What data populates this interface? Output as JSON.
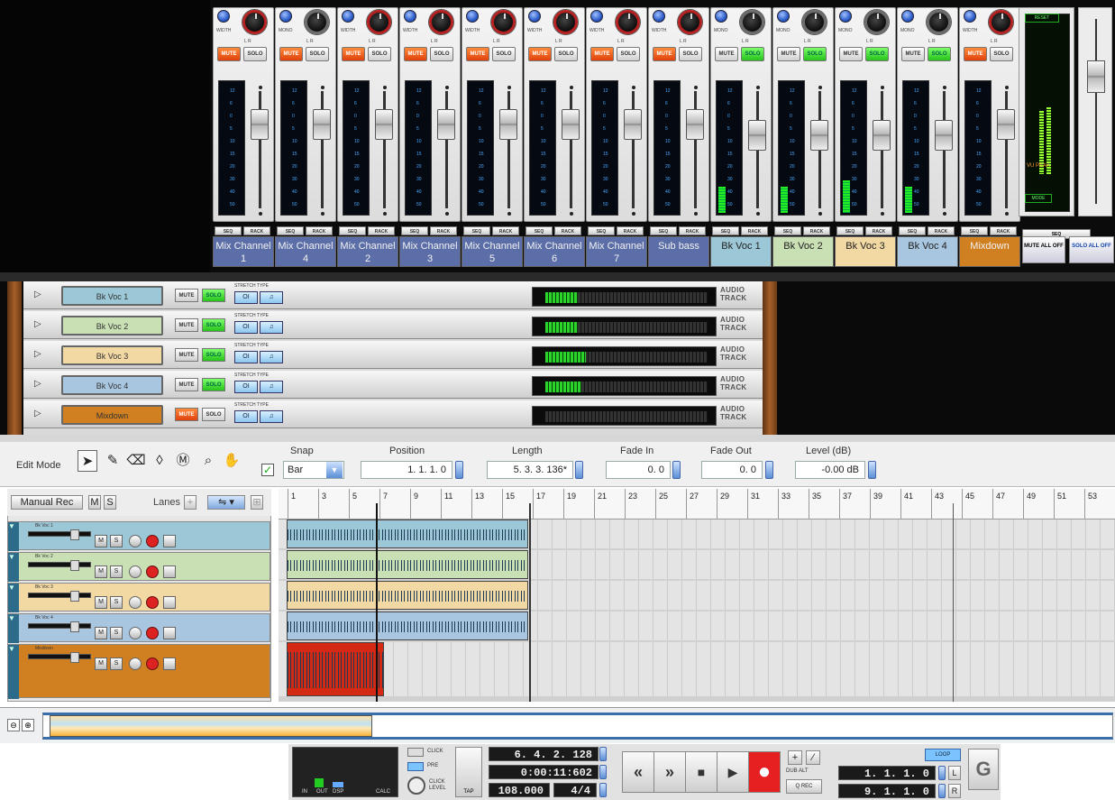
{
  "mixer": {
    "channels": [
      {
        "name": "Mix Channel 1",
        "label_color": "#5b6ea8",
        "mute_on": true,
        "solo_on": false,
        "knob": "red",
        "top_label": "WIDTH",
        "meter": 0
      },
      {
        "name": "Mix Channel 4",
        "label_color": "#5b6ea8",
        "mute_on": true,
        "solo_on": false,
        "knob": "gray",
        "top_label": "MONO",
        "meter": 0
      },
      {
        "name": "Mix Channel 2",
        "label_color": "#5b6ea8",
        "mute_on": true,
        "solo_on": false,
        "knob": "red",
        "top_label": "WIDTH",
        "meter": 0
      },
      {
        "name": "Mix Channel 3",
        "label_color": "#5b6ea8",
        "mute_on": true,
        "solo_on": false,
        "knob": "red",
        "top_label": "WIDTH",
        "meter": 0
      },
      {
        "name": "Mix Channel 5",
        "label_color": "#5b6ea8",
        "mute_on": true,
        "solo_on": false,
        "knob": "red",
        "top_label": "WIDTH",
        "meter": 0
      },
      {
        "name": "Mix Channel 6",
        "label_color": "#5b6ea8",
        "mute_on": true,
        "solo_on": false,
        "knob": "red",
        "top_label": "WIDTH",
        "meter": 0
      },
      {
        "name": "Mix Channel 7",
        "label_color": "#5b6ea8",
        "mute_on": true,
        "solo_on": false,
        "knob": "red",
        "top_label": "WIDTH",
        "meter": 0
      },
      {
        "name": "Sub bass",
        "label_color": "#5b6ea8",
        "mute_on": true,
        "solo_on": false,
        "knob": "red",
        "top_label": "WIDTH",
        "meter": 0
      },
      {
        "name": "Bk Voc 1",
        "label_color": "#9cc7d6",
        "mute_on": false,
        "solo_on": true,
        "knob": "gray",
        "top_label": "MONO",
        "meter": 0.2
      },
      {
        "name": "Bk Voc 2",
        "label_color": "#c9dfb4",
        "mute_on": false,
        "solo_on": true,
        "knob": "gray",
        "top_label": "MONO",
        "meter": 0.2
      },
      {
        "name": "Bk Voc 3",
        "label_color": "#f2d9a4",
        "mute_on": false,
        "solo_on": true,
        "knob": "gray",
        "top_label": "MONO",
        "meter": 0.25
      },
      {
        "name": "Bk Voc 4",
        "label_color": "#a9c6e0",
        "mute_on": false,
        "solo_on": true,
        "knob": "gray",
        "top_label": "MONO",
        "meter": 0.2
      },
      {
        "name": "Mixdown",
        "label_color": "#d08020",
        "mute_on": true,
        "solo_on": false,
        "knob": "red",
        "top_label": "WIDTH",
        "meter": 0
      }
    ],
    "mute_label": "MUTE",
    "solo_label": "SOLO",
    "seq_label": "SEQ",
    "rack_label": "RACK",
    "lr_label": "L   R",
    "meter_ticks": [
      "12",
      "6",
      "0",
      "5",
      "10",
      "15",
      "20",
      "30",
      "40",
      "50"
    ],
    "master": {
      "reset": "RESET",
      "vu_peak": "VU\nPEAK",
      "mode": "MODE",
      "seq": "SEQ",
      "mute_all": "MUTE\nALL OFF",
      "solo_all": "SOLO\nALL OFF"
    }
  },
  "rack": {
    "tracks": [
      {
        "name": "Bk Voc 1",
        "color": "#9cc7d6",
        "mute_on": false,
        "solo_on": true,
        "level": 0.2
      },
      {
        "name": "Bk Voc 2",
        "color": "#c9dfb4",
        "mute_on": false,
        "solo_on": true,
        "level": 0.2
      },
      {
        "name": "Bk Voc 3",
        "color": "#f2d9a4",
        "mute_on": false,
        "solo_on": true,
        "level": 0.25
      },
      {
        "name": "Bk Voc 4",
        "color": "#a9c6e0",
        "mute_on": false,
        "solo_on": true,
        "level": 0.22
      },
      {
        "name": "Mixdown",
        "color": "#d08020",
        "mute_on": true,
        "solo_on": false,
        "level": 0
      }
    ],
    "stretch_type": "STRETCH TYPE",
    "audio_track": "AUDIO TRACK",
    "mute_label": "MUTE",
    "solo_label": "SOLO"
  },
  "toolbar": {
    "edit_mode": "Edit Mode",
    "snap_label": "Snap",
    "snap_value": "Bar",
    "position_label": "Position",
    "position_value": "1.  1.  1.    0",
    "length_label": "Length",
    "length_value": "5.  3.  3. 136*",
    "fade_in_label": "Fade In",
    "fade_in_value": "0.    0",
    "fade_out_label": "Fade Out",
    "fade_out_value": "0.    0",
    "level_label": "Level (dB)",
    "level_value": "-0.00 dB"
  },
  "sequencer": {
    "manual_rec": "Manual Rec",
    "m": "M",
    "s": "S",
    "lanes_label": "Lanes",
    "ruler_marks": [
      "1",
      "3",
      "5",
      "7",
      "9",
      "11",
      "13",
      "15",
      "17",
      "19",
      "21",
      "23",
      "25",
      "27",
      "29",
      "31",
      "33",
      "35",
      "37",
      "39",
      "41",
      "43",
      "45",
      "47",
      "49",
      "51",
      "53"
    ],
    "lanes": [
      {
        "name": "Bk Voc 1",
        "color": "#9cc7d6"
      },
      {
        "name": "Bk Voc 2",
        "color": "#c9dfb4"
      },
      {
        "name": "Bk Voc 3",
        "color": "#f2d9a4"
      },
      {
        "name": "Bk Voc 4",
        "color": "#a9c6e0"
      },
      {
        "name": "Mixdown",
        "color": "#d08020"
      }
    ]
  },
  "transport": {
    "click": "CLICK",
    "pre": "PRE",
    "click_level": "CLICK LEVEL",
    "tap": "TAP",
    "in": "IN",
    "out": "OUT",
    "dsp": "DSP",
    "calc": "CALC",
    "position": "6.  4.  2. 128",
    "time": "0:00:11:602",
    "tempo": "108.000",
    "signature": "4/4",
    "dub_alt": "DUB  ALT",
    "q_rec": "Q REC",
    "loop": "LOOP",
    "left_locator": "1.  1.  1.    0",
    "right_locator": "9.  1.  1.    0",
    "l": "L",
    "r": "R",
    "rewind_glyph": "«",
    "ff_glyph": "»",
    "stop_glyph": "■",
    "play_glyph": "▶",
    "record_glyph": "●"
  }
}
